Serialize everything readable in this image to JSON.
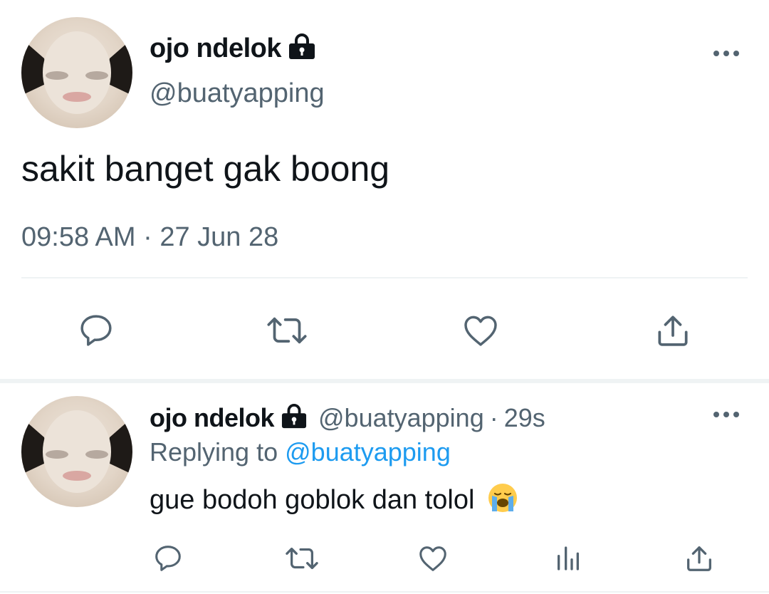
{
  "main_tweet": {
    "display_name": "ojo ndelok",
    "handle": "@buatyapping",
    "text": "sakit banget gak boong",
    "time": "09:58 AM",
    "separator": "·",
    "date": "27 Jun 28",
    "icons": [
      "lock-icon",
      "more-icon",
      "reply-icon",
      "retweet-icon",
      "like-icon",
      "share-icon"
    ]
  },
  "reply_tweet": {
    "display_name": "ojo ndelok",
    "handle": "@buatyapping",
    "separator": "·",
    "age": "29s",
    "replying_label": "Replying to",
    "replying_handle": "@buatyapping",
    "text": "gue bodoh goblok dan tolol",
    "emoji": "😭",
    "icons": [
      "lock-icon",
      "more-icon",
      "reply-icon",
      "retweet-icon",
      "like-icon",
      "analytics-icon",
      "share-icon"
    ]
  },
  "colors": {
    "text": "#0f1419",
    "muted": "#536471",
    "link": "#1d9bf0",
    "divider": "#eff3f4"
  }
}
